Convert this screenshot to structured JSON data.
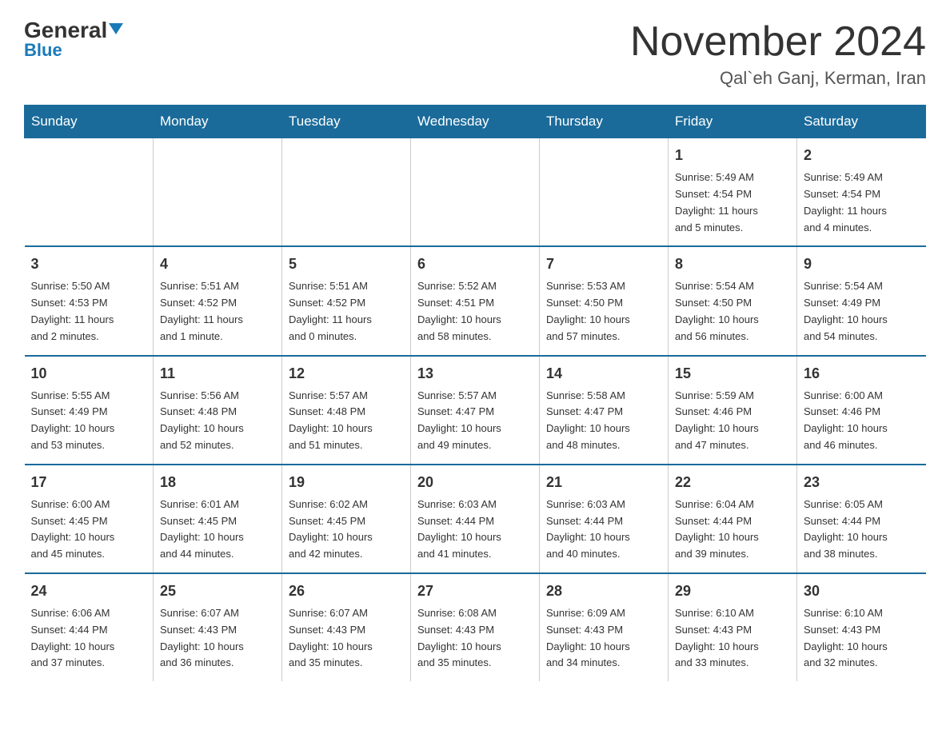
{
  "header": {
    "logo": {
      "general_text": "General",
      "blue_text": "Blue"
    },
    "month_title": "November 2024",
    "location": "Qal`eh Ganj, Kerman, Iran"
  },
  "weekdays": [
    "Sunday",
    "Monday",
    "Tuesday",
    "Wednesday",
    "Thursday",
    "Friday",
    "Saturday"
  ],
  "weeks": [
    [
      {
        "day": "",
        "info": ""
      },
      {
        "day": "",
        "info": ""
      },
      {
        "day": "",
        "info": ""
      },
      {
        "day": "",
        "info": ""
      },
      {
        "day": "",
        "info": ""
      },
      {
        "day": "1",
        "info": "Sunrise: 5:49 AM\nSunset: 4:54 PM\nDaylight: 11 hours\nand 5 minutes."
      },
      {
        "day": "2",
        "info": "Sunrise: 5:49 AM\nSunset: 4:54 PM\nDaylight: 11 hours\nand 4 minutes."
      }
    ],
    [
      {
        "day": "3",
        "info": "Sunrise: 5:50 AM\nSunset: 4:53 PM\nDaylight: 11 hours\nand 2 minutes."
      },
      {
        "day": "4",
        "info": "Sunrise: 5:51 AM\nSunset: 4:52 PM\nDaylight: 11 hours\nand 1 minute."
      },
      {
        "day": "5",
        "info": "Sunrise: 5:51 AM\nSunset: 4:52 PM\nDaylight: 11 hours\nand 0 minutes."
      },
      {
        "day": "6",
        "info": "Sunrise: 5:52 AM\nSunset: 4:51 PM\nDaylight: 10 hours\nand 58 minutes."
      },
      {
        "day": "7",
        "info": "Sunrise: 5:53 AM\nSunset: 4:50 PM\nDaylight: 10 hours\nand 57 minutes."
      },
      {
        "day": "8",
        "info": "Sunrise: 5:54 AM\nSunset: 4:50 PM\nDaylight: 10 hours\nand 56 minutes."
      },
      {
        "day": "9",
        "info": "Sunrise: 5:54 AM\nSunset: 4:49 PM\nDaylight: 10 hours\nand 54 minutes."
      }
    ],
    [
      {
        "day": "10",
        "info": "Sunrise: 5:55 AM\nSunset: 4:49 PM\nDaylight: 10 hours\nand 53 minutes."
      },
      {
        "day": "11",
        "info": "Sunrise: 5:56 AM\nSunset: 4:48 PM\nDaylight: 10 hours\nand 52 minutes."
      },
      {
        "day": "12",
        "info": "Sunrise: 5:57 AM\nSunset: 4:48 PM\nDaylight: 10 hours\nand 51 minutes."
      },
      {
        "day": "13",
        "info": "Sunrise: 5:57 AM\nSunset: 4:47 PM\nDaylight: 10 hours\nand 49 minutes."
      },
      {
        "day": "14",
        "info": "Sunrise: 5:58 AM\nSunset: 4:47 PM\nDaylight: 10 hours\nand 48 minutes."
      },
      {
        "day": "15",
        "info": "Sunrise: 5:59 AM\nSunset: 4:46 PM\nDaylight: 10 hours\nand 47 minutes."
      },
      {
        "day": "16",
        "info": "Sunrise: 6:00 AM\nSunset: 4:46 PM\nDaylight: 10 hours\nand 46 minutes."
      }
    ],
    [
      {
        "day": "17",
        "info": "Sunrise: 6:00 AM\nSunset: 4:45 PM\nDaylight: 10 hours\nand 45 minutes."
      },
      {
        "day": "18",
        "info": "Sunrise: 6:01 AM\nSunset: 4:45 PM\nDaylight: 10 hours\nand 44 minutes."
      },
      {
        "day": "19",
        "info": "Sunrise: 6:02 AM\nSunset: 4:45 PM\nDaylight: 10 hours\nand 42 minutes."
      },
      {
        "day": "20",
        "info": "Sunrise: 6:03 AM\nSunset: 4:44 PM\nDaylight: 10 hours\nand 41 minutes."
      },
      {
        "day": "21",
        "info": "Sunrise: 6:03 AM\nSunset: 4:44 PM\nDaylight: 10 hours\nand 40 minutes."
      },
      {
        "day": "22",
        "info": "Sunrise: 6:04 AM\nSunset: 4:44 PM\nDaylight: 10 hours\nand 39 minutes."
      },
      {
        "day": "23",
        "info": "Sunrise: 6:05 AM\nSunset: 4:44 PM\nDaylight: 10 hours\nand 38 minutes."
      }
    ],
    [
      {
        "day": "24",
        "info": "Sunrise: 6:06 AM\nSunset: 4:44 PM\nDaylight: 10 hours\nand 37 minutes."
      },
      {
        "day": "25",
        "info": "Sunrise: 6:07 AM\nSunset: 4:43 PM\nDaylight: 10 hours\nand 36 minutes."
      },
      {
        "day": "26",
        "info": "Sunrise: 6:07 AM\nSunset: 4:43 PM\nDaylight: 10 hours\nand 35 minutes."
      },
      {
        "day": "27",
        "info": "Sunrise: 6:08 AM\nSunset: 4:43 PM\nDaylight: 10 hours\nand 35 minutes."
      },
      {
        "day": "28",
        "info": "Sunrise: 6:09 AM\nSunset: 4:43 PM\nDaylight: 10 hours\nand 34 minutes."
      },
      {
        "day": "29",
        "info": "Sunrise: 6:10 AM\nSunset: 4:43 PM\nDaylight: 10 hours\nand 33 minutes."
      },
      {
        "day": "30",
        "info": "Sunrise: 6:10 AM\nSunset: 4:43 PM\nDaylight: 10 hours\nand 32 minutes."
      }
    ]
  ]
}
